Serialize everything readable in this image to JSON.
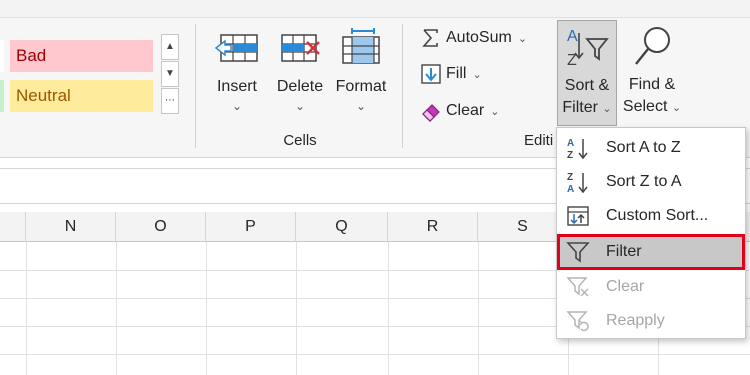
{
  "styles_gallery": {
    "items": [
      {
        "label": "Bad",
        "bg": "#ffc7ce",
        "fg": "#9c0006"
      },
      {
        "label": "Neutral",
        "bg": "#ffeb9c",
        "fg": "#9c5700"
      }
    ],
    "scroll_up": "▲",
    "scroll_down": "▼",
    "more": "⋯"
  },
  "cells_group": {
    "label": "Cells",
    "buttons": [
      {
        "label": "Insert",
        "icon": "insert-cells-icon"
      },
      {
        "label": "Delete",
        "icon": "delete-cells-icon"
      },
      {
        "label": "Format",
        "icon": "format-cells-icon"
      }
    ],
    "chevron": "⌄"
  },
  "editing_group": {
    "label": "Editi",
    "autosum": "AutoSum",
    "fill": "Fill",
    "clear": "Clear",
    "sort_filter": {
      "line1": "Sort &",
      "line2": "Filter"
    },
    "find_select": {
      "line1": "Find &",
      "line2": "Select"
    },
    "dropdown_glyph": "⌄"
  },
  "column_headers": [
    "N",
    "O",
    "P",
    "Q",
    "R",
    "S"
  ],
  "sort_filter_menu": {
    "items": [
      {
        "label": "Sort A to Z",
        "icon": "sort-a-to-z-icon",
        "enabled": true
      },
      {
        "label": "Sort Z to A",
        "icon": "sort-z-to-a-icon",
        "enabled": true
      },
      {
        "label": "Custom Sort...",
        "icon": "custom-sort-icon",
        "enabled": true
      },
      {
        "label": "Filter",
        "icon": "filter-icon",
        "enabled": true,
        "highlighted": true
      },
      {
        "label": "Clear",
        "icon": "clear-filter-icon",
        "enabled": false
      },
      {
        "label": "Reapply",
        "icon": "reapply-filter-icon",
        "enabled": false
      }
    ],
    "highlight_color": "#e3001b"
  }
}
